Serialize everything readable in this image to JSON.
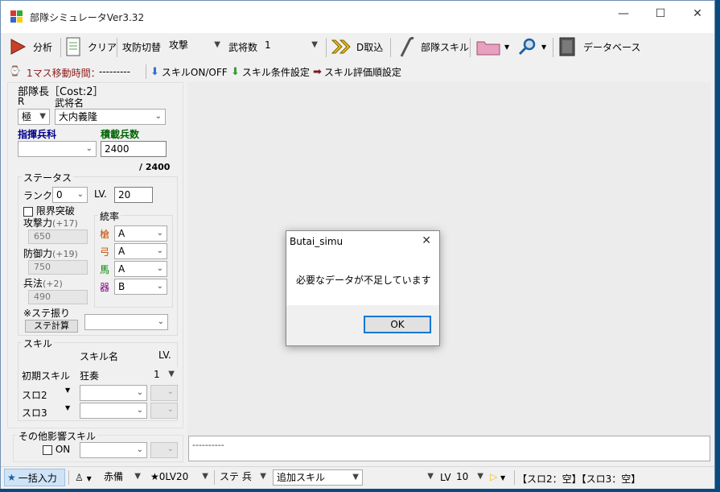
{
  "window": {
    "title": "部隊シミュレータVer3.32",
    "minimize": "—",
    "maximize": "☐",
    "close": "✕"
  },
  "toolbar": {
    "analyze": "分析",
    "clear": "クリア",
    "atk_def_label": "攻防切替",
    "atk_def_value": "攻撃",
    "general_count_label": "武将数",
    "general_count_value": "1",
    "d_import": "D取込",
    "unit_skill": "部隊スキル",
    "database": "データベース"
  },
  "toolbar2": {
    "move_time_label": "1マス移動時間：",
    "move_time_value": "---------",
    "skill_onoff": "スキルON/OFF",
    "skill_condition": "スキル条件設定",
    "skill_eval_order": "スキル評価順設定"
  },
  "leader": {
    "header": "部隊長［Cost:2］",
    "r_label": "R",
    "name_label": "武将名",
    "rarity": "極",
    "name": "大内義隆",
    "command_label": "指揮兵科",
    "troops_label": "積載兵数",
    "command_value": "",
    "troops_value": "2400",
    "troops_max": "/ 2400"
  },
  "status": {
    "title": "ステータス",
    "rank_label": "ランク",
    "rank_value": "0",
    "lv_label": "LV.",
    "lv_value": "20",
    "limit_break_label": "限界突破",
    "attack_label": "攻撃力",
    "attack_bonus": "(+17)",
    "attack_value": "650",
    "defense_label": "防御力",
    "defense_bonus": "(+19)",
    "defense_value": "750",
    "tactics_label": "兵法",
    "tactics_bonus": "(+2)",
    "tactics_value": "490",
    "stat_alloc_label": "※ステ振り",
    "stat_calc_button": "ステ計算",
    "stat_alloc_value": "",
    "command_title": "統率",
    "spear_label": "槍",
    "spear_value": "A",
    "bow_label": "弓",
    "bow_value": "A",
    "horse_label": "馬",
    "horse_value": "A",
    "weapon_label": "器",
    "weapon_value": "B"
  },
  "skills": {
    "title": "スキル",
    "name_header": "スキル名",
    "lv_header": "LV.",
    "initial_label": "初期スキル",
    "initial_name": "狂奏",
    "initial_lv": "1",
    "slot2_label": "スロ2",
    "slot3_label": "スロ3"
  },
  "other_skill": {
    "title": "その他影響スキル",
    "on_label": "ON"
  },
  "log": {
    "text": "----------"
  },
  "dialog": {
    "title": "Butai_simu",
    "message": "必要なデータが不足しています",
    "ok": "OK",
    "close": "✕"
  },
  "statusbar": {
    "bulk_input": "一括入力",
    "red_prep": "赤備",
    "lv_preset": "★0LV20",
    "stat_type": "ステ 兵",
    "add_skill": "追加スキル",
    "lv_label": "LV",
    "lv_value": "10",
    "slot_summary": "【スロ2：空】【スロ3：空】"
  },
  "colors": {
    "accent": "#0078d7",
    "background": "#f0f0f0",
    "desktop": "#0a4a7e",
    "spear": "#c05000",
    "bow": "#c05000",
    "horse": "#008000",
    "weapon": "#800080"
  }
}
